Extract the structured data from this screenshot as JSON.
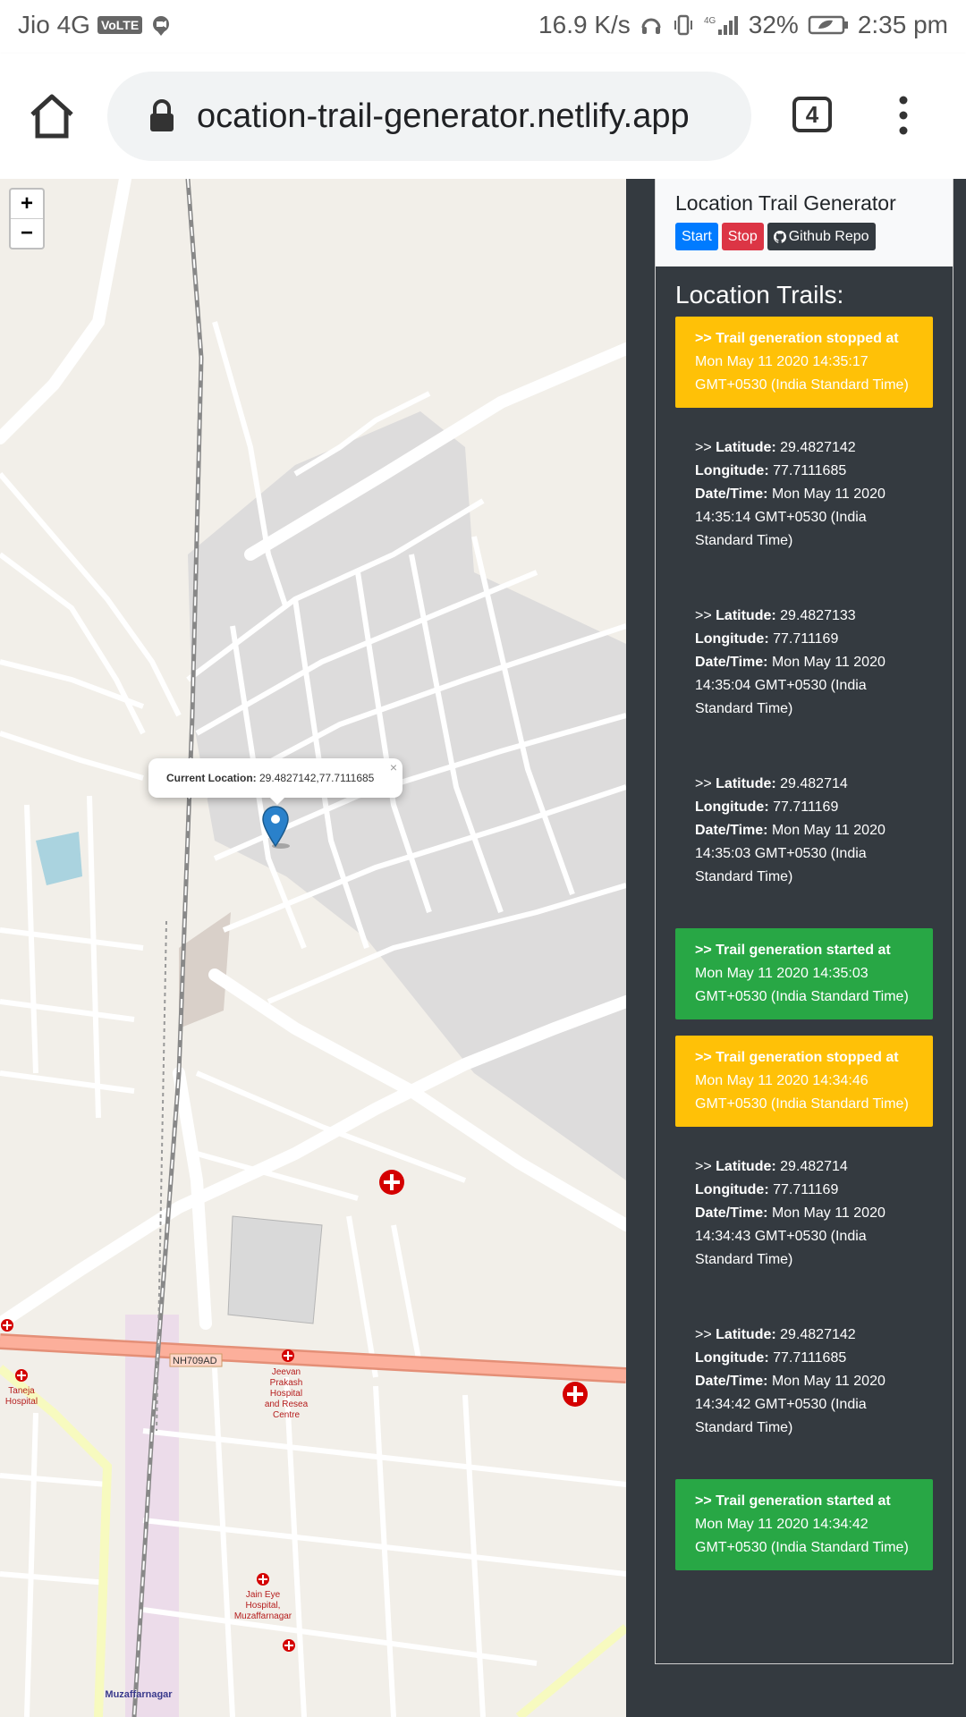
{
  "status_bar": {
    "carrier": "Jio 4G",
    "volte": "VoLTE",
    "speed": "16.9 K/s",
    "network": "4G",
    "battery": "32%",
    "time": "2:35 pm"
  },
  "browser": {
    "url": "ocation-trail-generator.netlify.app",
    "tab_count": "4"
  },
  "map": {
    "zoom_in": "+",
    "zoom_out": "−",
    "popup_label": "Current Location:",
    "popup_value": " 29.4827142,77.7111685",
    "popup_close": "×",
    "road_label": "NH709AD",
    "places": [
      "Jeevan Prakash Hospital and Research Centre",
      "Taneja Hospital",
      "Muzaffarnagar",
      "Jain Eye Hospital, Muzaffarnagar"
    ]
  },
  "app": {
    "title": "Location Trail Generator",
    "start_label": "Start",
    "stop_label": "Stop",
    "github_label": "Github Repo",
    "trails_title": "Location Trails:"
  },
  "labels": {
    "prefix": ">> ",
    "latitude": "Latitude:",
    "longitude": "Longitude:",
    "datetime": "Date/Time:"
  },
  "trails": [
    {
      "type": "stopped",
      "heading": ">> Trail generation stopped at",
      "text": " Mon May 11 2020 14:35:17 GMT+0530 (India Standard Time)"
    },
    {
      "type": "location",
      "lat": "29.4827142",
      "lng": "77.7111685",
      "datetime": "Mon May 11 2020 14:35:14 GMT+0530 (India Standard Time)"
    },
    {
      "type": "location",
      "lat": "29.4827133",
      "lng": "77.711169",
      "datetime": "Mon May 11 2020 14:35:04 GMT+0530 (India Standard Time)"
    },
    {
      "type": "location",
      "lat": "29.482714",
      "lng": "77.711169",
      "datetime": "Mon May 11 2020 14:35:03 GMT+0530 (India Standard Time)"
    },
    {
      "type": "started",
      "heading": ">> Trail generation started at",
      "text": " Mon May 11 2020 14:35:03 GMT+0530 (India Standard Time)"
    },
    {
      "type": "stopped",
      "heading": ">> Trail generation stopped at",
      "text": " Mon May 11 2020 14:34:46 GMT+0530 (India Standard Time)"
    },
    {
      "type": "location",
      "lat": "29.482714",
      "lng": "77.711169",
      "datetime": "Mon May 11 2020 14:34:43 GMT+0530 (India Standard Time)"
    },
    {
      "type": "location",
      "lat": "29.4827142",
      "lng": "77.7111685",
      "datetime": "Mon May 11 2020 14:34:42 GMT+0530 (India Standard Time)"
    },
    {
      "type": "started",
      "heading": ">> Trail generation started at",
      "text": " Mon May 11 2020 14:34:42 GMT+0530 (India Standard Time)"
    }
  ]
}
